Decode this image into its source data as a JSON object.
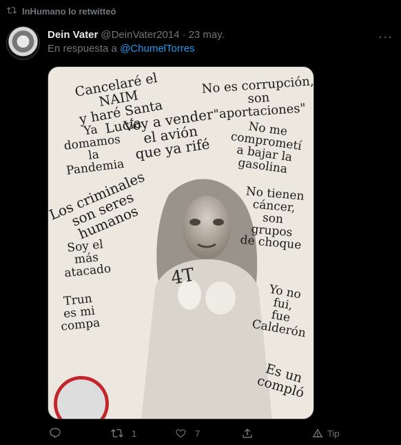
{
  "retweet": {
    "label": "InHumano lo retwitteó"
  },
  "tweet": {
    "display_name": "Dein Vater",
    "handle": "@DeinVater2014",
    "date": "23 may.",
    "reply_prefix": "En respuesta a",
    "reply_to": "@ChumelTorres"
  },
  "meme": {
    "texts": [
      "Cancelaré el NAIM\ny haré Santa Lucía",
      "No es corrupción,\nson \"aportaciones\"",
      "Ya\ndomamos\nla\nPandemia",
      "Voy a vender\nel avión\nque ya rifé",
      "No me\ncomprometí\na bajar la\ngasolina",
      "Los criminales\nson seres\nhumanos",
      "No tienen\ncáncer,\nson\ngrupos\nde choque",
      "Soy el\nmás\natacado",
      "Trun\nes mi\ncompa",
      "Yo no\nfui,\nfue\nCalderón",
      "Es un\ncomplό",
      "4T"
    ]
  },
  "actions": {
    "reply_count": "",
    "retweet_count": "1",
    "like_count": "7",
    "tip_label": "Tip"
  },
  "colors": {
    "accent": "#1d9bf0",
    "muted": "#71767b",
    "text": "#e7e9ea",
    "bg": "#000000"
  }
}
